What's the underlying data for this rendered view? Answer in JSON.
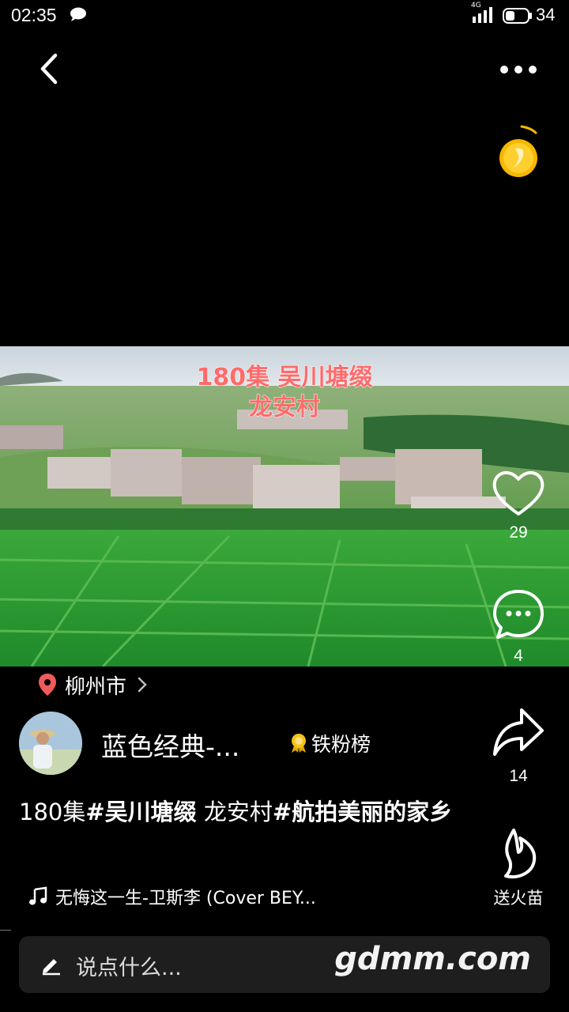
{
  "status_bar": {
    "time": "02:35",
    "network": "4G",
    "battery": "34"
  },
  "icons": {
    "back": "chevron-left-icon",
    "more": "more-dots-icon",
    "coin": "gold-coin-icon",
    "like": "heart-icon",
    "comment": "comment-bubble-icon",
    "share": "share-arrow-icon",
    "fire": "flame-icon",
    "location": "location-pin-icon",
    "location_arrow": "chevron-right-icon",
    "badge": "medal-icon",
    "music": "music-note-icon",
    "pen": "pen-icon"
  },
  "video": {
    "title_line1": "180集 吴川塘缀",
    "title_line2": "龙安村"
  },
  "actions": {
    "likes": "29",
    "comments": "4",
    "shares": "14",
    "fire_label": "送火苗"
  },
  "location": {
    "city": "柳州市"
  },
  "author": {
    "name": "蓝色经典-...",
    "fans_label": "铁粉榜"
  },
  "caption": {
    "prefix": "180集",
    "tag1": "#吴川塘缀",
    "middle": "  龙安村",
    "tag2": "#航拍美丽的家乡"
  },
  "music": {
    "title": "无悔这一生-卫斯李 (Cover BEY..."
  },
  "comment_bar": {
    "placeholder": "说点什么...",
    "watermark": "gdmm.com"
  },
  "colors": {
    "background": "#000000",
    "title_red": "#ff6b6b",
    "coin_gold": "#f5b800",
    "location_pin": "#f05a5a"
  }
}
